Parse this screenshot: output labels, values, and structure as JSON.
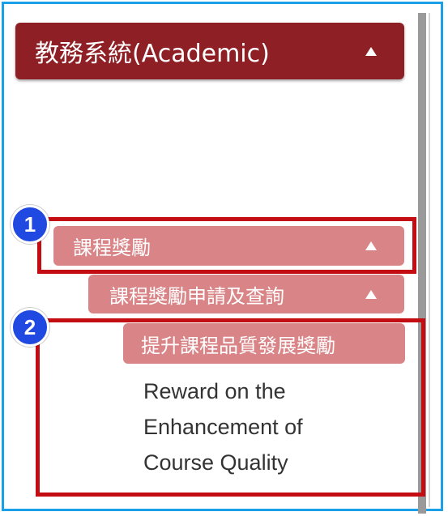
{
  "menu": {
    "academic_label": "教務系統(Academic)",
    "course_reward_label": "課程獎勵",
    "course_reward_apply_label": "課程獎勵申請及查詢",
    "quality_reward_label": "提升課程品質發展獎勵",
    "quality_reward_english": [
      "Reward on the",
      "Enhancement of",
      "Course Quality"
    ]
  },
  "annotations": {
    "badge_1": "1",
    "badge_2": "2"
  },
  "colors": {
    "frame": "#1aa0e8",
    "primary_menu": "#8e2025",
    "sub_menu": "#d98487",
    "highlight_box": "#c30d12",
    "badge": "#1f49e0"
  },
  "icons": {
    "expand": "up-triangle-icon"
  }
}
